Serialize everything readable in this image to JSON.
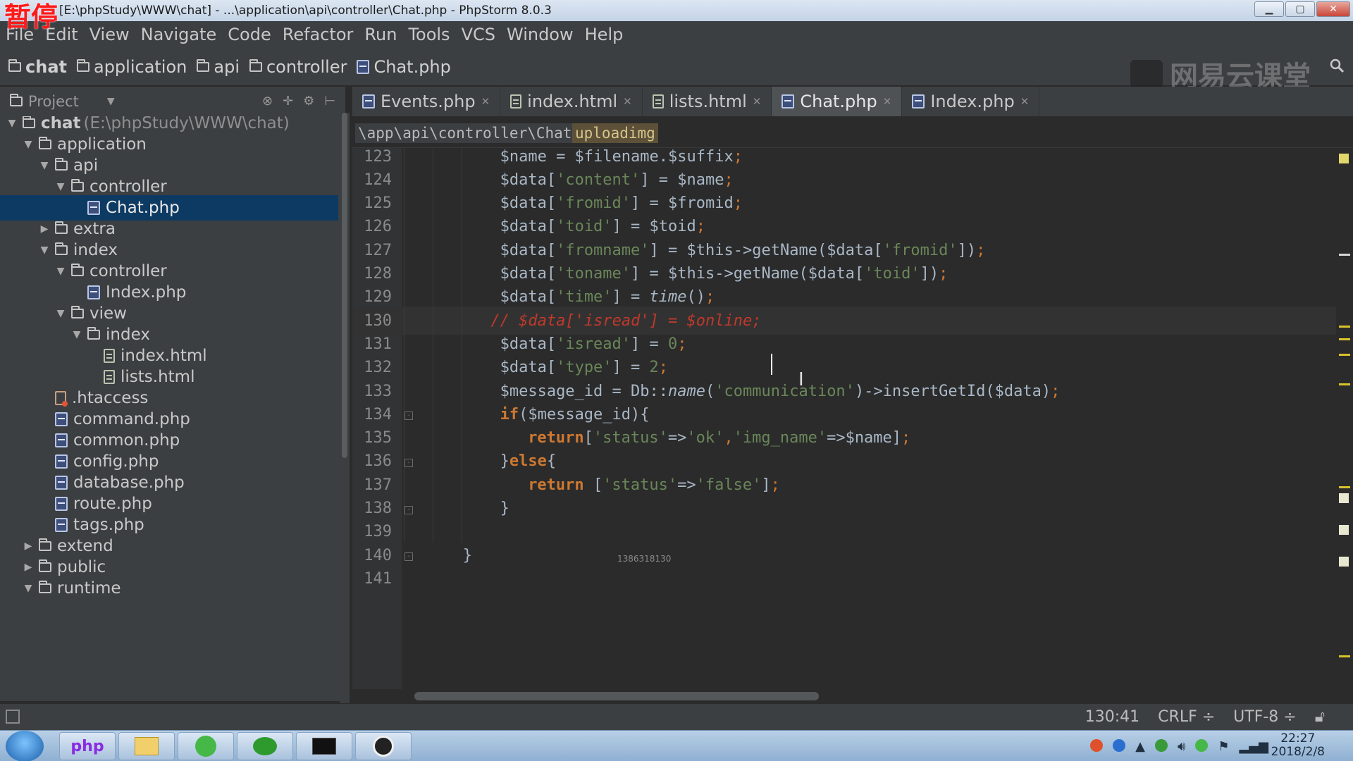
{
  "window": {
    "pause_label": "暂停",
    "title": "[E:\\phpStudy\\WWW\\chat] - ...\\application\\api\\controller\\Chat.php - PhpStorm 8.0.3",
    "controls": [
      "▁",
      "▢",
      "✕"
    ]
  },
  "menu": [
    "File",
    "Edit",
    "View",
    "Navigate",
    "Code",
    "Refactor",
    "Run",
    "Tools",
    "VCS",
    "Window",
    "Help"
  ],
  "breadcrumb": [
    "chat",
    "application",
    "api",
    "controller",
    "Chat.php"
  ],
  "watermark": "网易云课堂",
  "project_panel": {
    "title": "Project",
    "tree": [
      {
        "label": "chat",
        "extra": "(E:\\phpStudy\\WWW\\chat)",
        "type": "folder",
        "depth": 0,
        "arrow": "▼"
      },
      {
        "label": "application",
        "type": "folder",
        "depth": 1,
        "arrow": "▼"
      },
      {
        "label": "api",
        "type": "folder",
        "depth": 2,
        "arrow": "▼"
      },
      {
        "label": "controller",
        "type": "folder",
        "depth": 3,
        "arrow": "▼"
      },
      {
        "label": "Chat.php",
        "type": "php",
        "depth": 4,
        "arrow": "",
        "selected": true
      },
      {
        "label": "extra",
        "type": "folder",
        "depth": 2,
        "arrow": "▶"
      },
      {
        "label": "index",
        "type": "folder",
        "depth": 2,
        "arrow": "▼"
      },
      {
        "label": "controller",
        "type": "folder",
        "depth": 3,
        "arrow": "▼"
      },
      {
        "label": "Index.php",
        "type": "php",
        "depth": 4,
        "arrow": ""
      },
      {
        "label": "view",
        "type": "folder",
        "depth": 3,
        "arrow": "▼"
      },
      {
        "label": "index",
        "type": "folder",
        "depth": 4,
        "arrow": "▼"
      },
      {
        "label": "index.html",
        "type": "html",
        "depth": 5,
        "arrow": ""
      },
      {
        "label": "lists.html",
        "type": "html",
        "depth": 5,
        "arrow": ""
      },
      {
        "label": ".htaccess",
        "type": "htaccess",
        "depth": 2,
        "arrow": ""
      },
      {
        "label": "command.php",
        "type": "php",
        "depth": 2,
        "arrow": ""
      },
      {
        "label": "common.php",
        "type": "php",
        "depth": 2,
        "arrow": ""
      },
      {
        "label": "config.php",
        "type": "php",
        "depth": 2,
        "arrow": ""
      },
      {
        "label": "database.php",
        "type": "php",
        "depth": 2,
        "arrow": ""
      },
      {
        "label": "route.php",
        "type": "php",
        "depth": 2,
        "arrow": ""
      },
      {
        "label": "tags.php",
        "type": "php",
        "depth": 2,
        "arrow": ""
      },
      {
        "label": "extend",
        "type": "folder",
        "depth": 1,
        "arrow": "▶"
      },
      {
        "label": "public",
        "type": "folder",
        "depth": 1,
        "arrow": "▶"
      },
      {
        "label": "runtime",
        "type": "folder",
        "depth": 1,
        "arrow": "▼"
      }
    ]
  },
  "tabs": [
    {
      "label": "Events.php",
      "type": "php",
      "active": false
    },
    {
      "label": "index.html",
      "type": "html",
      "active": false
    },
    {
      "label": "lists.html",
      "type": "html",
      "active": false
    },
    {
      "label": "Chat.php",
      "type": "php",
      "active": true
    },
    {
      "label": "Index.php",
      "type": "php",
      "active": false
    }
  ],
  "editor": {
    "path_crumb": "\\app\\api\\controller\\Chat",
    "method_crumb": "uploadimg",
    "overlay_text": "1386318130",
    "current_line": 130,
    "lines": [
      {
        "n": 123,
        "indent": 8,
        "tokens": [
          [
            "t",
            "$name = $filename."
          ],
          [
            "t",
            "$suffix"
          ],
          [
            "p",
            ";"
          ]
        ]
      },
      {
        "n": 124,
        "indent": 8,
        "tokens": [
          [
            "t",
            "$data["
          ],
          [
            "s",
            "'content'"
          ],
          [
            "t",
            "] = $name"
          ],
          [
            "p",
            ";"
          ]
        ]
      },
      {
        "n": 125,
        "indent": 8,
        "tokens": [
          [
            "t",
            "$data["
          ],
          [
            "s",
            "'fromid'"
          ],
          [
            "t",
            "] = $fromid"
          ],
          [
            "p",
            ";"
          ]
        ]
      },
      {
        "n": 126,
        "indent": 8,
        "tokens": [
          [
            "t",
            "$data["
          ],
          [
            "s",
            "'toid'"
          ],
          [
            "t",
            "] = $toid"
          ],
          [
            "p",
            ";"
          ]
        ]
      },
      {
        "n": 127,
        "indent": 8,
        "tokens": [
          [
            "t",
            "$data["
          ],
          [
            "s",
            "'fromname'"
          ],
          [
            "t",
            "] = $this->getName($data["
          ],
          [
            "s",
            "'fromid'"
          ],
          [
            "t",
            "])"
          ],
          [
            "p",
            ";"
          ]
        ]
      },
      {
        "n": 128,
        "indent": 8,
        "tokens": [
          [
            "t",
            "$data["
          ],
          [
            "s",
            "'toname'"
          ],
          [
            "t",
            "] = $this->getName($data["
          ],
          [
            "s",
            "'toid'"
          ],
          [
            "t",
            "])"
          ],
          [
            "p",
            ";"
          ]
        ]
      },
      {
        "n": 129,
        "indent": 8,
        "tokens": [
          [
            "t",
            "$data["
          ],
          [
            "s",
            "'time'"
          ],
          [
            "t",
            "] = "
          ],
          [
            "f",
            "time"
          ],
          [
            "t",
            "()"
          ],
          [
            "p",
            ";"
          ]
        ]
      },
      {
        "n": 130,
        "indent": 7,
        "tokens": [
          [
            "c",
            "// $data['isread'] = $online;"
          ]
        ]
      },
      {
        "n": 131,
        "indent": 8,
        "tokens": [
          [
            "t",
            "$data["
          ],
          [
            "s",
            "'isread'"
          ],
          [
            "t",
            "] = "
          ],
          [
            "num",
            "0"
          ],
          [
            "p",
            ";"
          ]
        ]
      },
      {
        "n": 132,
        "indent": 8,
        "tokens": [
          [
            "t",
            "$data["
          ],
          [
            "s",
            "'type'"
          ],
          [
            "t",
            "] = "
          ],
          [
            "num",
            "2"
          ],
          [
            "p",
            ";"
          ]
        ]
      },
      {
        "n": 133,
        "indent": 8,
        "tokens": [
          [
            "t",
            "$message_id = Db::"
          ],
          [
            "f",
            "name"
          ],
          [
            "t",
            "("
          ],
          [
            "s",
            "'communication'"
          ],
          [
            "t",
            ")->insertGetId($data)"
          ],
          [
            "p",
            ";"
          ]
        ]
      },
      {
        "n": 134,
        "indent": 8,
        "tokens": [
          [
            "k",
            "if"
          ],
          [
            "t",
            "($message_id){"
          ]
        ]
      },
      {
        "n": 135,
        "indent": 11,
        "tokens": [
          [
            "k",
            "return"
          ],
          [
            "t",
            "["
          ],
          [
            "s",
            "'status'"
          ],
          [
            "t",
            "=>"
          ],
          [
            "s",
            "'ok'"
          ],
          [
            "p",
            ","
          ],
          [
            "s",
            "'img_name'"
          ],
          [
            "t",
            "=>$name]"
          ],
          [
            "p",
            ";"
          ]
        ]
      },
      {
        "n": 136,
        "indent": 8,
        "tokens": [
          [
            "t",
            "}"
          ],
          [
            "k",
            "else"
          ],
          [
            "t",
            "{"
          ]
        ]
      },
      {
        "n": 137,
        "indent": 11,
        "tokens": [
          [
            "k",
            "return"
          ],
          [
            "t",
            " ["
          ],
          [
            "s",
            "'status'"
          ],
          [
            "t",
            "=>"
          ],
          [
            "s",
            "'false'"
          ],
          [
            "t",
            "]"
          ],
          [
            "p",
            ";"
          ]
        ]
      },
      {
        "n": 138,
        "indent": 8,
        "tokens": [
          [
            "t",
            "}"
          ]
        ]
      },
      {
        "n": 139,
        "indent": 0,
        "tokens": []
      },
      {
        "n": 140,
        "indent": 4,
        "tokens": [
          [
            "t",
            "}"
          ]
        ]
      },
      {
        "n": 141,
        "indent": 0,
        "tokens": []
      }
    ]
  },
  "status": {
    "position": "130:41",
    "line_sep": "CRLF ÷",
    "encoding": "UTF-8 ÷"
  },
  "taskbar": {
    "time": "22:27",
    "date": "2018/2/8"
  },
  "colors": {
    "accent": "#0d3a63",
    "string": "#6a8759",
    "keyword": "#cc7832",
    "comment": "#c0392b"
  }
}
